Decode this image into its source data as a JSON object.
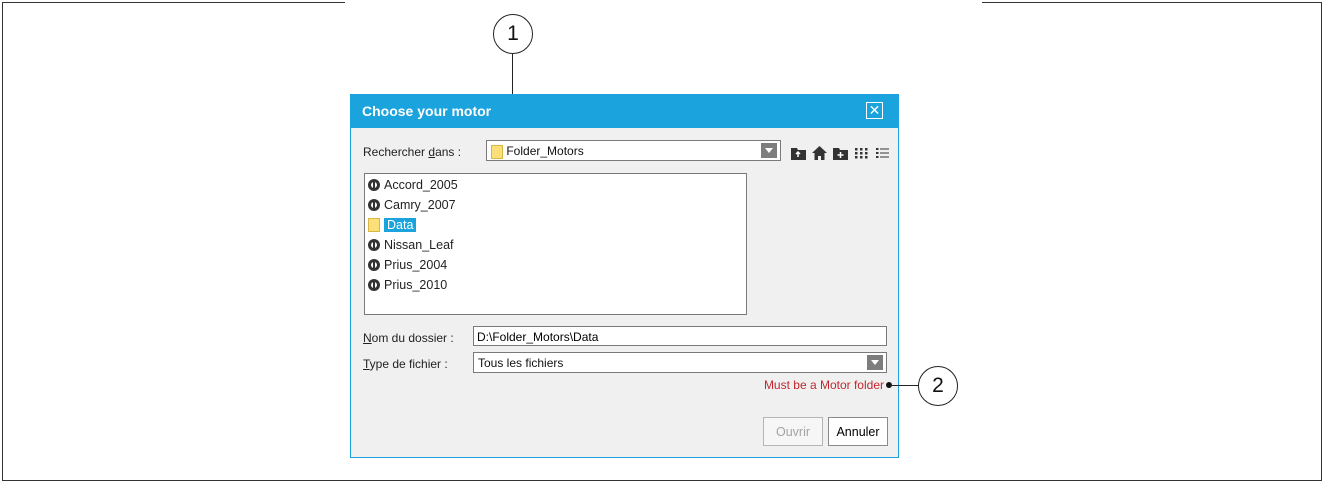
{
  "callouts": {
    "one": "1",
    "two": "2"
  },
  "dialog": {
    "title": "Choose your motor",
    "close_icon": "close-icon",
    "look_in": {
      "label_pre": "Rechercher ",
      "label_u": "d",
      "label_post": "ans :",
      "value": "Folder_Motors"
    },
    "toolbar_icons": [
      "up-folder-icon",
      "home-icon",
      "new-folder-icon",
      "list-view-icon",
      "details-view-icon"
    ],
    "files": [
      {
        "name": "Accord_2005",
        "icon": "motor-icon",
        "selected": false
      },
      {
        "name": "Camry_2007",
        "icon": "motor-icon",
        "selected": false
      },
      {
        "name": "Data",
        "icon": "folder-icon",
        "selected": true
      },
      {
        "name": "Nissan_Leaf",
        "icon": "motor-icon",
        "selected": false
      },
      {
        "name": "Prius_2004",
        "icon": "motor-icon",
        "selected": false
      },
      {
        "name": "Prius_2010",
        "icon": "motor-icon",
        "selected": false
      }
    ],
    "folder_name": {
      "label_u": "N",
      "label_post": "om du dossier :",
      "value": "D:\\Folder_Motors\\Data"
    },
    "file_type": {
      "label_u": "T",
      "label_post": "ype de fichier :",
      "value": "Tous les fichiers"
    },
    "warning": "Must be a Motor folder",
    "buttons": {
      "open": "Ouvrir",
      "cancel": "Annuler"
    }
  },
  "colors": {
    "accent": "#1aa3dd",
    "warning": "#c0282e"
  }
}
